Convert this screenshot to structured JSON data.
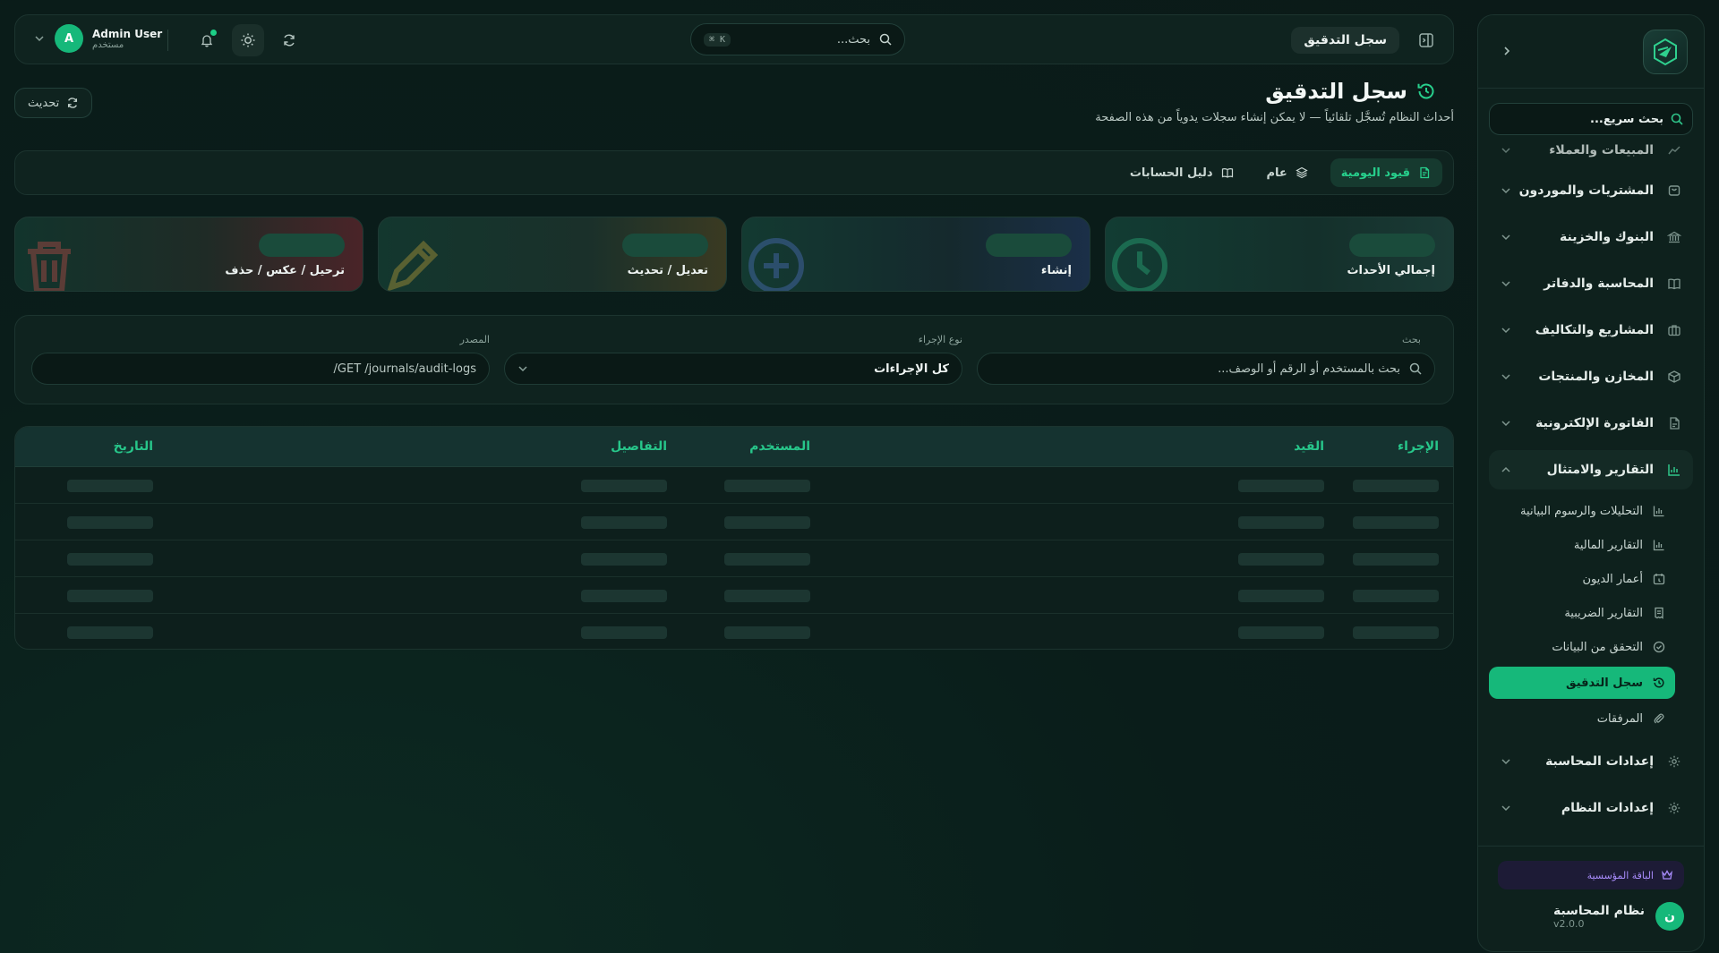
{
  "sidebar": {
    "search_label": "بحث سريع...",
    "items": [
      {
        "label": "المبيعات والعملاء",
        "icon": "trend-icon"
      },
      {
        "label": "المشتريات والموردون",
        "icon": "cart-icon"
      },
      {
        "label": "البنوك والخزينة",
        "icon": "bank-icon"
      },
      {
        "label": "المحاسبة والدفاتر",
        "icon": "book-icon"
      },
      {
        "label": "المشاريع والتكاليف",
        "icon": "briefcase-icon"
      },
      {
        "label": "المخازن والمنتجات",
        "icon": "box-icon"
      },
      {
        "label": "الفاتورة الإلكترونية",
        "icon": "file-icon"
      },
      {
        "label": "التقارير والامتثال",
        "icon": "bar-chart-icon"
      },
      {
        "label": "إعدادات المحاسبة",
        "icon": "gear-icon"
      },
      {
        "label": "إعدادات النظام",
        "icon": "gear-icon"
      }
    ],
    "sub_items": [
      {
        "label": "التحليلات والرسوم البيانية"
      },
      {
        "label": "التقارير المالية"
      },
      {
        "label": "أعمار الديون"
      },
      {
        "label": "التقارير الضريبية"
      },
      {
        "label": "التحقق من البيانات"
      },
      {
        "label": "سجل التدقيق"
      },
      {
        "label": "المرفقات"
      }
    ],
    "plan_badge": "الباقة المؤسسية",
    "system_avatar": "ن",
    "system_name": "نظام المحاسبة",
    "version": "v2.0.0"
  },
  "topbar": {
    "page_label": "سجل التدقيق",
    "search_placeholder": "بحث...",
    "shortcut": "⌘ K",
    "user_initial": "A",
    "user_name": "Admin User",
    "user_role": "مستخدم"
  },
  "page": {
    "title": "سجل التدقيق",
    "subtitle": "أحداث النظام تُسجَّل تلقائياً — لا يمكن إنشاء سجلات يدوياً من هذه الصفحة",
    "refresh_label": "تحديث"
  },
  "tabs": [
    {
      "label": "قيود اليومية",
      "active": true
    },
    {
      "label": "عام",
      "active": false
    },
    {
      "label": "دليل الحسابات",
      "active": false
    }
  ],
  "stats": [
    {
      "label": "إجمالي الأحداث",
      "icon": "clock-icon"
    },
    {
      "label": "إنشاء",
      "icon": "plus-circle-icon"
    },
    {
      "label": "تعديل / تحديث",
      "icon": "pencil-icon"
    },
    {
      "label": "ترحيل / عكس / حذف",
      "icon": "trash-icon"
    }
  ],
  "filters": {
    "search_label": "بحث",
    "search_placeholder": "بحث بالمستخدم أو الرقم أو الوصف...",
    "action_label": "نوع الإجراء",
    "action_value": "كل الإجراءات",
    "source_label": "المصدر",
    "source_value": "/GET /journals/audit-logs"
  },
  "table": {
    "headers": [
      "الإجراء",
      "القيد",
      "المستخدم",
      "التفاصيل",
      "التاريخ"
    ],
    "loading_rows": 5
  },
  "colors": {
    "accent": "#16b87a",
    "background": "#0b1a18",
    "panel": "#0f231f"
  }
}
